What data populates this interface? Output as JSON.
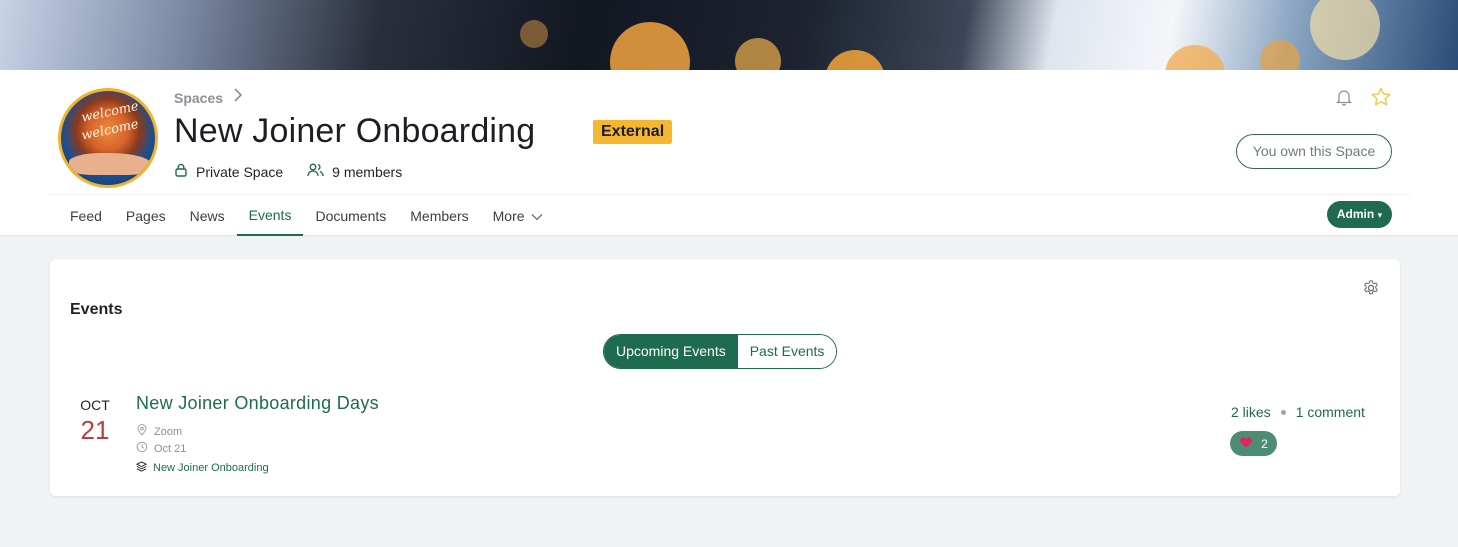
{
  "breadcrumb": {
    "label": "Spaces"
  },
  "space": {
    "title": "New Joiner Onboarding",
    "badge": "External",
    "privacy": "Private Space",
    "members": "9 members",
    "ownership": "You own this Space",
    "avatar_words": [
      "welcome",
      "welcome"
    ]
  },
  "nav": {
    "tabs": [
      {
        "label": "Feed"
      },
      {
        "label": "Pages"
      },
      {
        "label": "News"
      },
      {
        "label": "Events"
      },
      {
        "label": "Documents"
      },
      {
        "label": "Members"
      },
      {
        "label": "More"
      }
    ],
    "active_tab": "Events",
    "admin": "Admin"
  },
  "events": {
    "title": "Events",
    "toggle": {
      "upcoming": "Upcoming Events",
      "past": "Past Events",
      "selected": "Upcoming Events"
    },
    "items": [
      {
        "month": "OCT",
        "day": "21",
        "title": "New Joiner Onboarding Days",
        "location": "Zoom",
        "date": "Oct 21",
        "space": "New Joiner Onboarding",
        "likes": "2 likes",
        "comments": "1 comment",
        "reactions": "2"
      }
    ]
  },
  "colors": {
    "accent": "#1e6b50",
    "badge": "#f5b731",
    "date_day": "#c23b3b",
    "reaction_heart": "#e0245e",
    "star": "#f2c94c"
  },
  "icons": [
    "chevron-right-icon",
    "lock-icon",
    "members-icon",
    "bell-icon",
    "star-icon",
    "chevron-down-icon",
    "gear-icon",
    "location-pin-icon",
    "clock-icon",
    "layers-icon",
    "heart-icon"
  ]
}
